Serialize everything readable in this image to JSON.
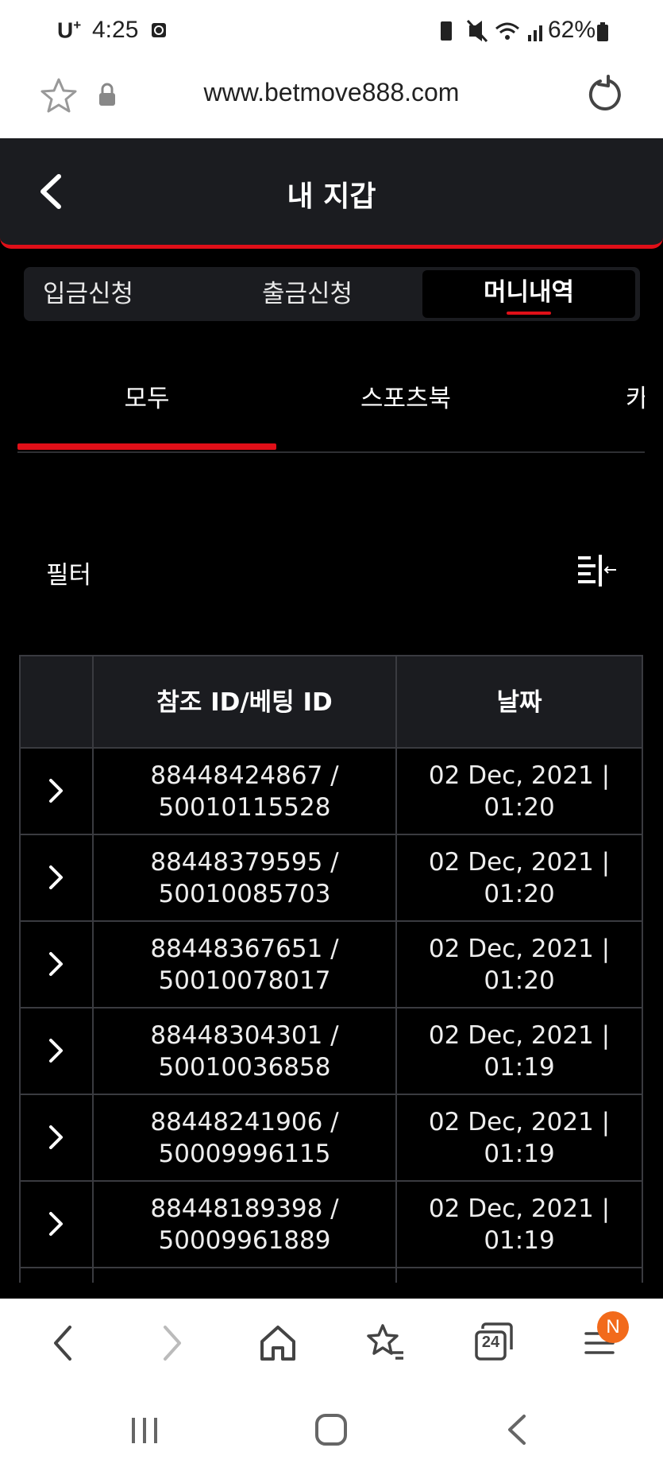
{
  "status": {
    "carrier": "U",
    "carrier_sup": "+",
    "time": "4:25",
    "battery": "62%"
  },
  "browser": {
    "url": "www.betmove888.com"
  },
  "header": {
    "title": "내 지갑"
  },
  "wallet_tabs": [
    {
      "label": "입금신청"
    },
    {
      "label": "출금신청"
    },
    {
      "label": "머니내역"
    }
  ],
  "sub_tabs": [
    {
      "label": "모두"
    },
    {
      "label": "스포츠북"
    },
    {
      "label": "카"
    }
  ],
  "filter": {
    "label": "필터"
  },
  "table": {
    "headers": [
      "참조 ID/베팅 ID",
      "날짜"
    ],
    "rows": [
      {
        "ref": "88448424867 /",
        "bet": "50010115528",
        "date": "02 Dec, 2021 |",
        "time": "01:20"
      },
      {
        "ref": "88448379595 /",
        "bet": "50010085703",
        "date": "02 Dec, 2021 |",
        "time": "01:20"
      },
      {
        "ref": "88448367651 /",
        "bet": "50010078017",
        "date": "02 Dec, 2021 |",
        "time": "01:20"
      },
      {
        "ref": "88448304301 /",
        "bet": "50010036858",
        "date": "02 Dec, 2021 |",
        "time": "01:19"
      },
      {
        "ref": "88448241906 /",
        "bet": "50009996115",
        "date": "02 Dec, 2021 |",
        "time": "01:19"
      },
      {
        "ref": "88448189398 /",
        "bet": "50009961889",
        "date": "02 Dec, 2021 |",
        "time": "01:19"
      }
    ]
  },
  "bottom_nav": {
    "tabs_count": "24",
    "menu_badge": "N"
  },
  "colors": {
    "accent": "#e00f18",
    "panel": "#1b1c20",
    "badge": "#f26a1b"
  }
}
